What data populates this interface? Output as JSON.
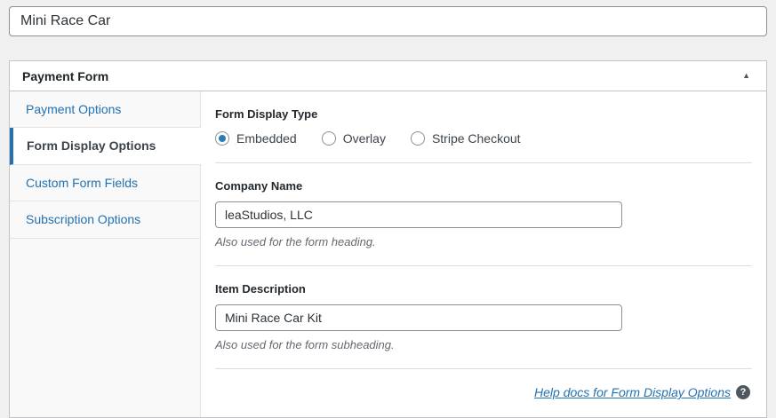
{
  "title_field": {
    "value": "Mini Race Car"
  },
  "metabox": {
    "title": "Payment Form",
    "toggle_glyph": "▲"
  },
  "tabs": [
    {
      "label": "Payment Options",
      "active": false
    },
    {
      "label": "Form Display Options",
      "active": true
    },
    {
      "label": "Custom Form Fields",
      "active": false
    },
    {
      "label": "Subscription Options",
      "active": false
    }
  ],
  "panel": {
    "display_type": {
      "label": "Form Display Type",
      "options": [
        {
          "label": "Embedded",
          "selected": true
        },
        {
          "label": "Overlay",
          "selected": false
        },
        {
          "label": "Stripe Checkout",
          "selected": false
        }
      ]
    },
    "company_name": {
      "label": "Company Name",
      "value": "leaStudios, LLC",
      "help": "Also used for the form heading."
    },
    "item_description": {
      "label": "Item Description",
      "value": "Mini Race Car Kit",
      "help": "Also used for the form subheading."
    },
    "help_link": {
      "label": "Help docs for Form Display Options",
      "icon_glyph": "?"
    }
  },
  "colors": {
    "accent_blue": "#2271b1",
    "page_background": "#f0f0f1",
    "box_border": "#c3c4c7",
    "radio_dot": "#2b7cb5",
    "helper_text": "#646970"
  }
}
